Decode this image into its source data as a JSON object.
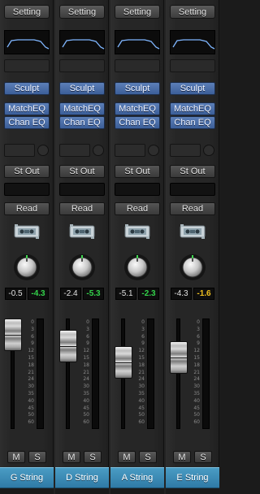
{
  "channel_strips": [
    {
      "setting_label": "Setting",
      "plugins": [
        "Sculpt",
        "MatchEQ",
        "Chan EQ"
      ],
      "output_label": "St Out",
      "automation_label": "Read",
      "volume_readout": "-0.5",
      "peak_readout": "-4.3",
      "peak_color": "#33d24a",
      "fader_position_db": -0.5,
      "mute_label": "M",
      "solo_label": "S",
      "track_name": "G String"
    },
    {
      "setting_label": "Setting",
      "plugins": [
        "Sculpt",
        "MatchEQ",
        "Chan EQ"
      ],
      "output_label": "St Out",
      "automation_label": "Read",
      "volume_readout": "-2.4",
      "peak_readout": "-5.3",
      "peak_color": "#33d24a",
      "fader_position_db": -2.4,
      "mute_label": "M",
      "solo_label": "S",
      "track_name": "D String"
    },
    {
      "setting_label": "Setting",
      "plugins": [
        "Sculpt",
        "MatchEQ",
        "Chan EQ"
      ],
      "output_label": "St Out",
      "automation_label": "Read",
      "volume_readout": "-5.1",
      "peak_readout": "-2.3",
      "peak_color": "#33d24a",
      "fader_position_db": -5.1,
      "mute_label": "M",
      "solo_label": "S",
      "track_name": "A String"
    },
    {
      "setting_label": "Setting",
      "plugins": [
        "Sculpt",
        "MatchEQ",
        "Chan EQ"
      ],
      "output_label": "St Out",
      "automation_label": "Read",
      "volume_readout": "-4.3",
      "peak_readout": "-1.6",
      "peak_color": "#f0c020",
      "fader_position_db": -4.3,
      "mute_label": "M",
      "solo_label": "S",
      "track_name": "E String"
    }
  ],
  "fader_scale_ticks": [
    "0",
    "3",
    "6",
    "9",
    "12",
    "15",
    "18",
    "21",
    "24",
    "30",
    "35",
    "40",
    "45",
    "50",
    "60"
  ],
  "meter_scale_ticks": [
    "0",
    "3",
    "6",
    "9",
    "12",
    "15",
    "18",
    "21",
    "24",
    "30"
  ],
  "colors": {
    "track_name_bg": "#3b8bb8",
    "plugin_button_bg": "#4a6ea8",
    "peak_ok": "#33d24a",
    "peak_warn": "#f0c020"
  }
}
